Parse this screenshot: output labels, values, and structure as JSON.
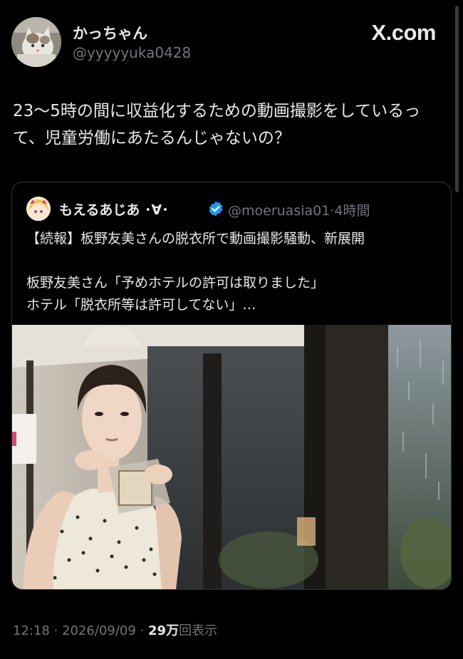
{
  "author": {
    "display_name": "かっちゃん",
    "handle": "@yyyyyuka0428"
  },
  "brand": {
    "label": "X.com"
  },
  "tweet": {
    "text": "23〜5時の間に収益化するための動画撮影をしているって、児童労働にあたるんじゃないの？"
  },
  "quoted": {
    "display_name": "もえるあじあ ･∀･",
    "handle": "@moeruasia01",
    "separator": "·",
    "time": "4時間",
    "text": "【続報】板野友美さんの脱衣所で動画撮影騒動、新展開\n\n板野友美さん「予めホテルの許可は取りました」\nホテル「脱衣所等は許可してない」…"
  },
  "footer": {
    "time": "12:18",
    "separator": "·",
    "date": "2026/09/09",
    "separator2": "·",
    "views_count": "29万",
    "views_label": "回表示"
  }
}
